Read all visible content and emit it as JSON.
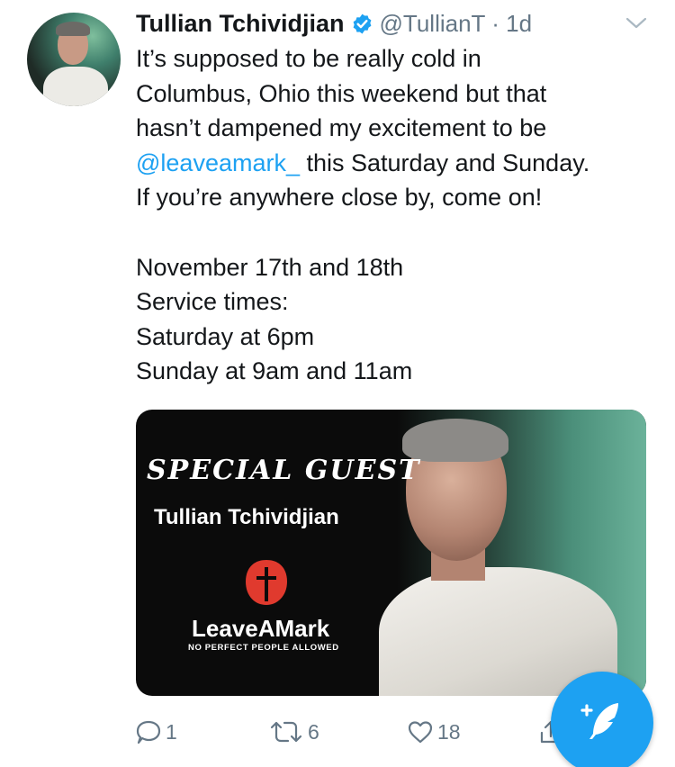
{
  "tweet": {
    "author_name": "Tullian Tchividjian",
    "handle": "@TullianT",
    "separator": "·",
    "timestamp": "1d",
    "verified": true,
    "lines": [
      {
        "text": "It’s supposed to be really cold in"
      },
      {
        "text": "Columbus, Ohio this weekend but that"
      },
      {
        "text": "hasn’t dampened my excitement to be"
      },
      {
        "mention": "@leaveamark_",
        "text": " this Saturday and Sunday."
      },
      {
        "text": "If you’re anywhere close by, come on!"
      },
      {
        "text": ""
      },
      {
        "text": "November 17th and 18th"
      },
      {
        "text": "Service times:"
      },
      {
        "text": "Saturday at 6pm"
      },
      {
        "text": "Sunday at 9am and 11am"
      }
    ]
  },
  "media": {
    "headline": "SPECIAL GUEST",
    "guest_name": "Tullian Tchividjian",
    "brand": "LeaveAMark",
    "tagline": "NO PERFECT PEOPLE ALLOWED"
  },
  "actions": {
    "reply_count": "1",
    "retweet_count": "6",
    "like_count": "18"
  },
  "icons": {
    "verified": "verified-badge-icon",
    "chevron": "chevron-down-icon",
    "reply": "reply-icon",
    "retweet": "retweet-icon",
    "like": "heart-icon",
    "share": "share-icon",
    "compose": "compose-tweet-icon"
  },
  "colors": {
    "accent": "#1da1f2",
    "text": "#14171a",
    "secondary": "#657786",
    "logo_red": "#e03a2e"
  }
}
